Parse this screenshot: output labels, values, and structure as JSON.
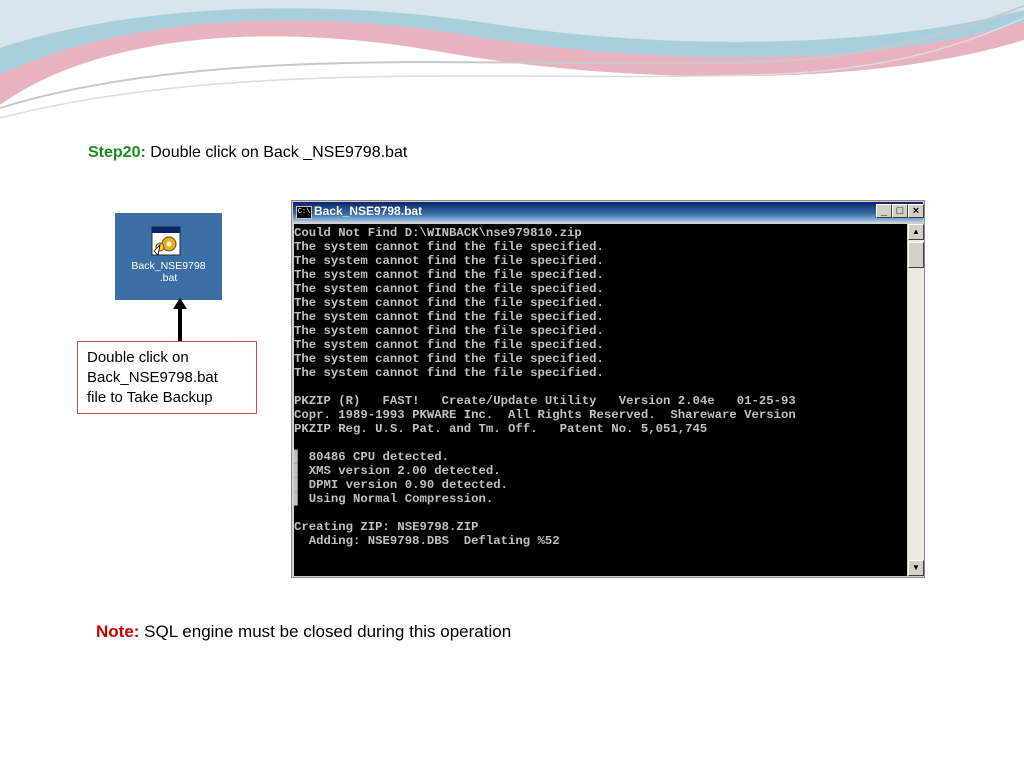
{
  "step": {
    "label": "Step20:",
    "text": " Double click on Back _NSE9798.bat"
  },
  "desktop_icon": {
    "line1": "Back_NSE9798",
    "line2": ".bat",
    "icon": "batch-file-gear-icon"
  },
  "callout": {
    "line1": "Double click on",
    "line2": "Back_NSE9798.bat",
    "line3": "file to Take Backup"
  },
  "window": {
    "title": "Back_NSE9798.bat",
    "icon_label": "C:\\",
    "buttons": {
      "minimize": "_",
      "maximize": "□",
      "close": "×"
    },
    "console_lines": [
      "Could Not Find D:\\WINBACK\\nse979810.zip",
      "The system cannot find the file specified.",
      "The system cannot find the file specified.",
      "The system cannot find the file specified.",
      "The system cannot find the file specified.",
      "The system cannot find the file specified.",
      "The system cannot find the file specified.",
      "The system cannot find the file specified.",
      "The system cannot find the file specified.",
      "The system cannot find the file specified.",
      "The system cannot find the file specified.",
      "",
      "PKZIP (R)   FAST!   Create/Update Utility   Version 2.04e   01-25-93",
      "Copr. 1989-1993 PKWARE Inc.  All Rights Reserved.  Shareware Version",
      "PKZIP Reg. U.S. Pat. and Tm. Off.   Patent No. 5,051,745",
      "",
      "▌ 80486 CPU detected.",
      "▌ XMS version 2.00 detected.",
      "▌ DPMI version 0.90 detected.",
      "▌ Using Normal Compression.",
      "",
      "Creating ZIP: NSE9798.ZIP",
      "  Adding: NSE9798.DBS  Deflating %52"
    ]
  },
  "note": {
    "label": "Note:",
    "text": " SQL engine must be closed during this operation"
  },
  "colors": {
    "step_label": "#1a8a1a",
    "note_label": "#cc0000",
    "desktop": "#3a6ea5",
    "callout_border": "#c0504d"
  }
}
